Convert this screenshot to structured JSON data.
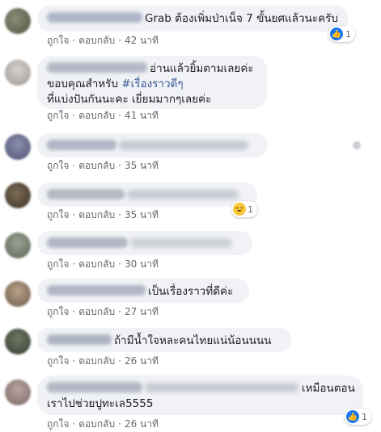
{
  "comments": [
    {
      "text": "Grab ต้องเพิ่มป่าเน็จ 7 ขั้นยศแล้วนะครับ",
      "like_label": "ถูกใจ",
      "reply_label": "ตอบกลับ",
      "time": "42 นาที",
      "reaction_count": "1"
    },
    {
      "text_line1": "อ่านแล้วยิ้มตามเลยค่ะ",
      "text_line2_prefix": "ขอบคุณสำหรับ ",
      "hashtag": "#เรื่องราวดีๆ",
      "text_line3": "ที่แบ่งปันกันนะคะ เยี่ยมมากๆเลยค่ะ",
      "like_label": "ถูกใจ",
      "reply_label": "ตอบกลับ",
      "time": "41 นาที"
    },
    {
      "like_label": "ถูกใจ",
      "reply_label": "ตอบกลับ",
      "time": "35 นาที"
    },
    {
      "like_label": "ถูกใจ",
      "reply_label": "ตอบกลับ",
      "time": "35 นาที",
      "reaction_count": "1"
    },
    {
      "like_label": "ถูกใจ",
      "reply_label": "ตอบกลับ",
      "time": "30 นาที"
    },
    {
      "text": "เป็นเรื่องราวที่ดีค่ะ",
      "like_label": "ถูกใจ",
      "reply_label": "ตอบกลับ",
      "time": "27 นาที"
    },
    {
      "text": "ถ้ามีน้ำใจหละคนไทยแน่น้อนนนน",
      "like_label": "ถูกใจ",
      "reply_label": "ตอบกลับ",
      "time": "26 นาที"
    },
    {
      "text_line1": "เหมือนตอน",
      "text_line2": "เราไปช่วยปูทะเล5555",
      "like_label": "ถูกใจ",
      "reply_label": "ตอบกลับ",
      "time": "26 นาที",
      "reaction_count": "1"
    }
  ],
  "colors": {
    "bubble_bg": "#f0f2f5",
    "action_text": "#65676b",
    "hashtag": "#385898",
    "like_blue": "#1877f2"
  }
}
